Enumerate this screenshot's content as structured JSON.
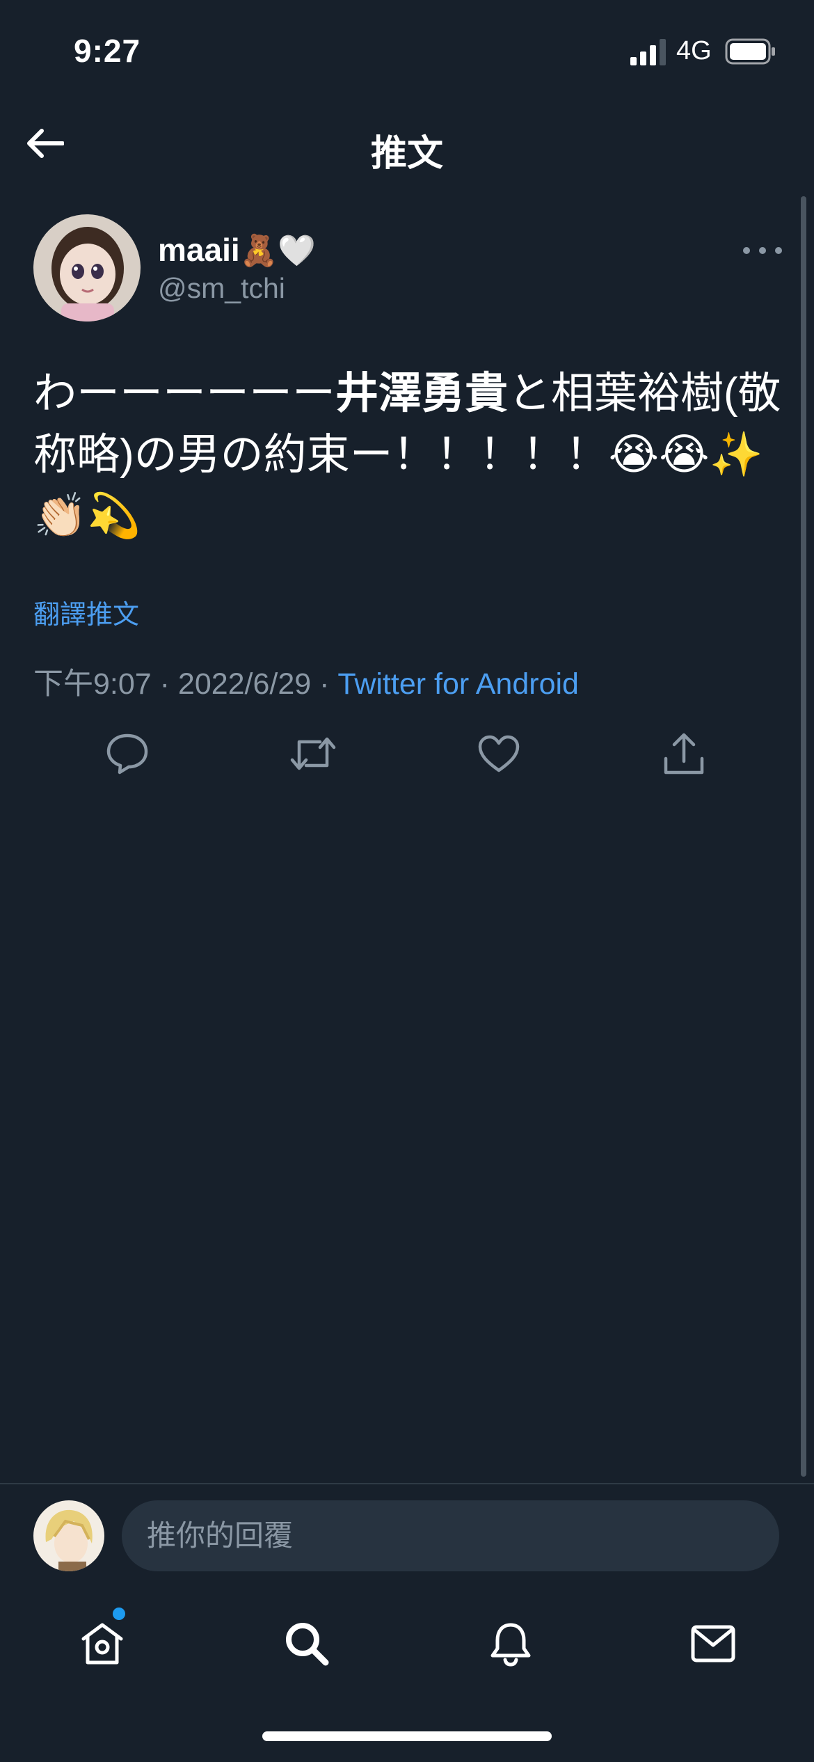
{
  "status_bar": {
    "time": "9:27",
    "network": "4G"
  },
  "header": {
    "title": "推文"
  },
  "tweet": {
    "display_name": "maaii",
    "name_emoji": "🧸🤍",
    "handle": "@sm_tchi",
    "text_part1": "わーーーーーー",
    "text_bold": "井澤勇貴",
    "text_part2": "と相葉裕樹(敬称略)の男の約束ー！！！！！😭😭✨👏🏻💫",
    "translate_label": "翻譯推文",
    "timestamp": "下午9:07 · 2022/6/29 · ",
    "source": "Twitter for Android"
  },
  "reply": {
    "placeholder": "推你的回覆"
  },
  "icons": {
    "back": "arrow-left-icon",
    "more": "more-horizontal-icon",
    "reply": "comment-icon",
    "retweet": "retweet-icon",
    "like": "heart-icon",
    "share": "share-icon",
    "home": "home-icon",
    "search": "search-icon",
    "notifications": "bell-icon",
    "messages": "mail-icon"
  },
  "colors": {
    "background": "#17202b",
    "accent": "#1d9bf0",
    "secondary_text": "#8b98a5"
  }
}
